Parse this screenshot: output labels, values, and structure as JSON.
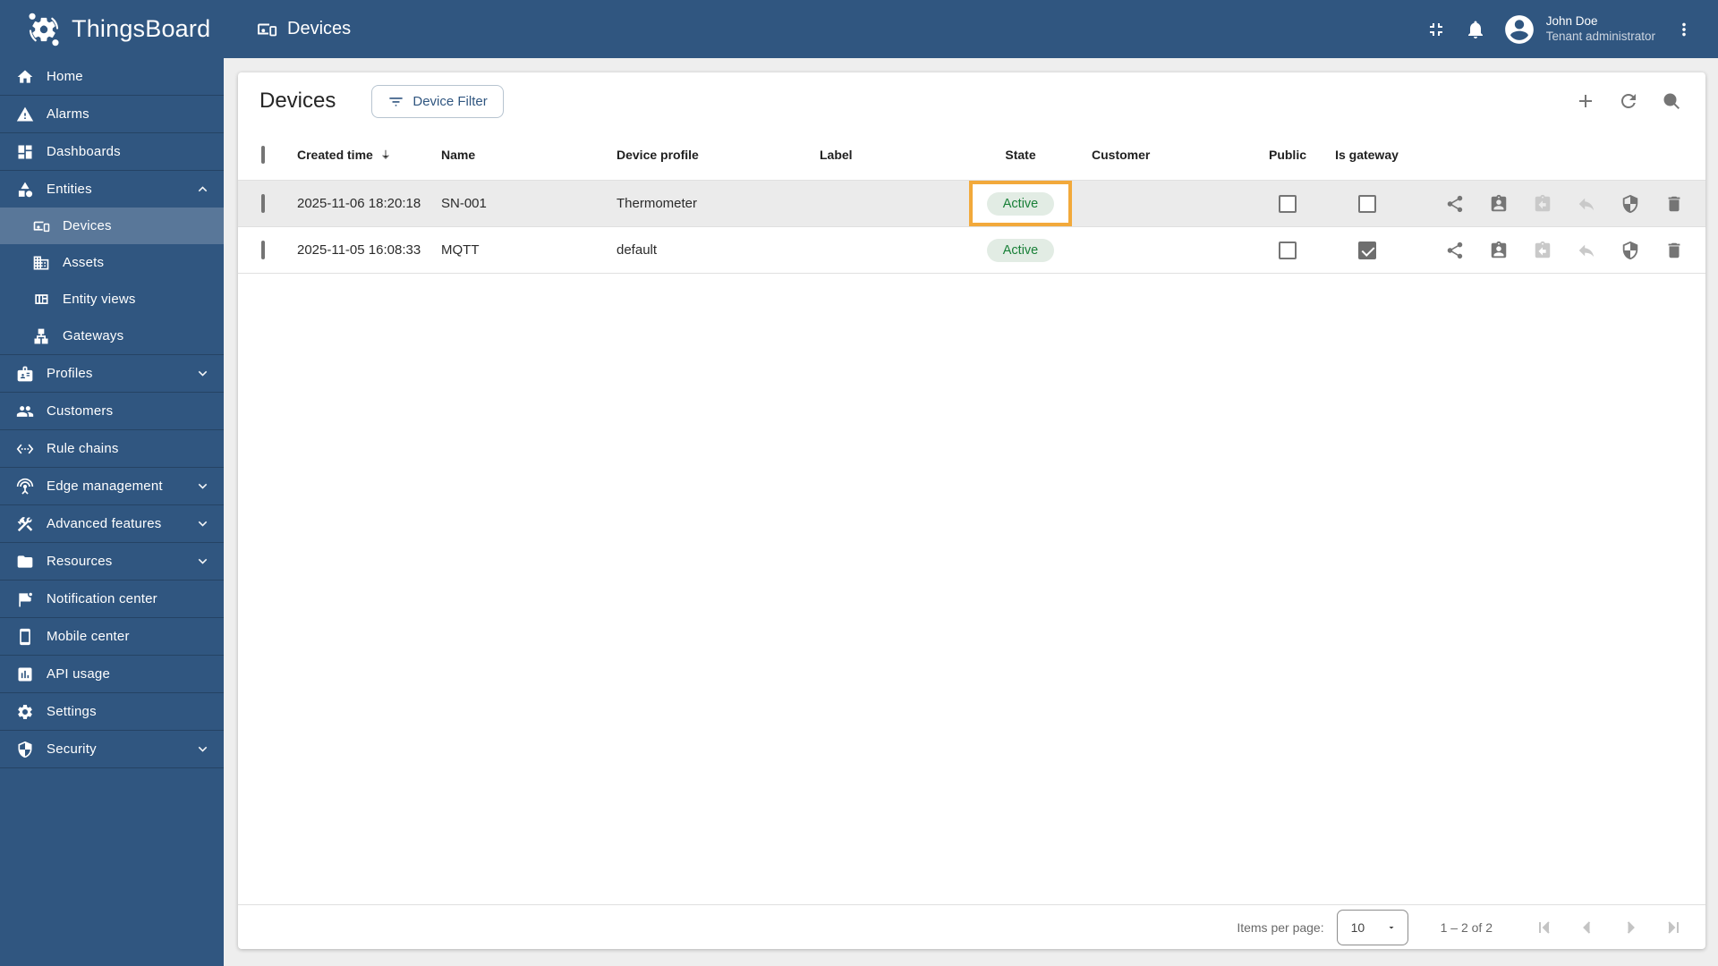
{
  "colors": {
    "primary": "#305680",
    "sidebar_selected": "rgba(255,255,255,0.2)",
    "content_background": "#EEEEEE",
    "row_hover": "#EBEBEB",
    "active_badge_text": "#198038",
    "active_badge_background": "#E2ECE4",
    "target_highlight": "#F2A93B",
    "disabled_icon": "#C9C9C9"
  },
  "topbar": {
    "logo_text": "ThingsBoard",
    "page_title": "Devices",
    "user": {
      "name": "John Doe",
      "role": "Tenant administrator"
    },
    "icons": [
      "thingsboard-logo",
      "devices",
      "fullscreen-exit",
      "notifications-bell",
      "account-circle",
      "more-vert"
    ]
  },
  "sidebar": {
    "items": [
      {
        "label": "Home",
        "icon": "home"
      },
      {
        "label": "Alarms",
        "icon": "warning-triangle"
      },
      {
        "label": "Dashboards",
        "icon": "dashboards-grid"
      },
      {
        "label": "Entities",
        "icon": "entities-shapes",
        "expanded": true,
        "children": [
          {
            "label": "Devices",
            "icon": "devices",
            "active": true
          },
          {
            "label": "Assets",
            "icon": "building"
          },
          {
            "label": "Entity views",
            "icon": "view-quilt"
          },
          {
            "label": "Gateways",
            "icon": "lan-tree"
          }
        ]
      },
      {
        "label": "Profiles",
        "icon": "badge-card",
        "collapsible": true
      },
      {
        "label": "Customers",
        "icon": "people"
      },
      {
        "label": "Rule chains",
        "icon": "code-brackets"
      },
      {
        "label": "Edge management",
        "icon": "antenna",
        "collapsible": true
      },
      {
        "label": "Advanced features",
        "icon": "tools",
        "collapsible": true
      },
      {
        "label": "Resources",
        "icon": "folder",
        "collapsible": true
      },
      {
        "label": "Notification center",
        "icon": "flag-dot"
      },
      {
        "label": "Mobile center",
        "icon": "smartphone"
      },
      {
        "label": "API usage",
        "icon": "bar-chart-box"
      },
      {
        "label": "Settings",
        "icon": "gear"
      },
      {
        "label": "Security",
        "icon": "shield",
        "collapsible": true
      }
    ]
  },
  "main": {
    "title": "Devices",
    "filter_button_label": "Device Filter",
    "header_icons": [
      "add-plus",
      "refresh",
      "search-magnifier"
    ],
    "table": {
      "columns": [
        "Created time",
        "Name",
        "Device profile",
        "Label",
        "State",
        "Customer",
        "Public",
        "Is gateway"
      ],
      "sort": {
        "column": "Created time",
        "direction": "desc"
      },
      "row_actions": [
        "share",
        "assign-to-customer",
        "unassign-from-customer",
        "make-private",
        "manage-credentials",
        "delete"
      ],
      "row_actions_disabled": [
        "unassign-from-customer",
        "make-private"
      ],
      "rows": [
        {
          "created": "2025-11-06 18:20:18",
          "name": "SN-001",
          "profile": "Thermometer",
          "label": "",
          "state": "Active",
          "customer": "",
          "public": false,
          "gateway": false,
          "state_highlighted": true,
          "row_highlighted": true
        },
        {
          "created": "2025-11-05 16:08:33",
          "name": "MQTT",
          "profile": "default",
          "label": "",
          "state": "Active",
          "customer": "",
          "public": false,
          "gateway": true
        }
      ]
    },
    "footer": {
      "items_per_page_label": "Items per page:",
      "items_per_page_value": "10",
      "range_label": "1 – 2 of 2"
    }
  }
}
